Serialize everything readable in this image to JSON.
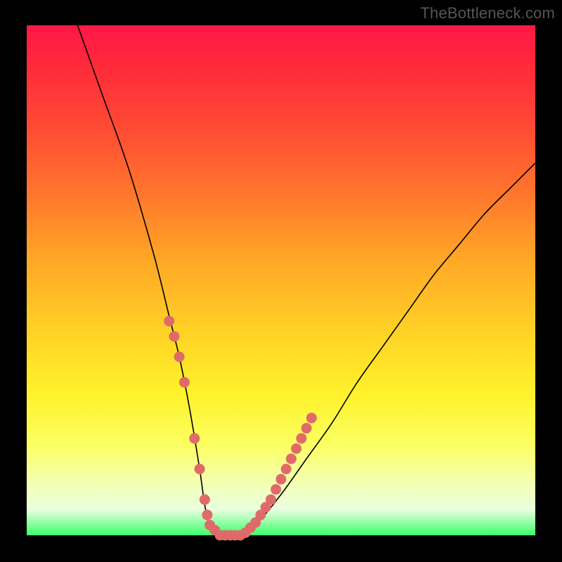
{
  "watermark": "TheBottleneck.com",
  "chart_data": {
    "type": "line",
    "title": "",
    "xlabel": "",
    "ylabel": "",
    "xlim": [
      0,
      100
    ],
    "ylim": [
      0,
      100
    ],
    "grid": false,
    "legend": false,
    "series": [
      {
        "name": "curve",
        "color": "#000000",
        "x": [
          10,
          15,
          20,
          25,
          28,
          30,
          32,
          34,
          35,
          36,
          38,
          40,
          42,
          45,
          50,
          55,
          60,
          65,
          70,
          75,
          80,
          85,
          90,
          95,
          100
        ],
        "y": [
          100,
          86,
          72,
          55,
          43,
          35,
          25,
          13,
          6,
          2,
          0,
          0,
          0,
          2,
          8,
          15,
          22,
          30,
          37,
          44,
          51,
          57,
          63,
          68,
          73
        ]
      },
      {
        "name": "highlight-dots",
        "color": "#e06a6a",
        "x": [
          28,
          29,
          30,
          31,
          33,
          34,
          35,
          35.5,
          36,
          37,
          38,
          39,
          40,
          41,
          42,
          43,
          44,
          45,
          46,
          47,
          48,
          49,
          50,
          51,
          52,
          53,
          54,
          55,
          56
        ],
        "y": [
          42,
          39,
          35,
          30,
          19,
          13,
          7,
          4,
          2,
          1,
          0,
          0,
          0,
          0,
          0,
          0.5,
          1.5,
          2.5,
          4,
          5.5,
          7,
          9,
          11,
          13,
          15,
          17,
          19,
          21,
          23
        ]
      }
    ],
    "gradient_stops": [
      {
        "pos": 0.0,
        "color": "#ff1846"
      },
      {
        "pos": 0.2,
        "color": "#ff4a34"
      },
      {
        "pos": 0.46,
        "color": "#ffa726"
      },
      {
        "pos": 0.72,
        "color": "#fff12a"
      },
      {
        "pos": 0.9,
        "color": "#f3ffb4"
      },
      {
        "pos": 1.0,
        "color": "#3aff6a"
      }
    ]
  }
}
